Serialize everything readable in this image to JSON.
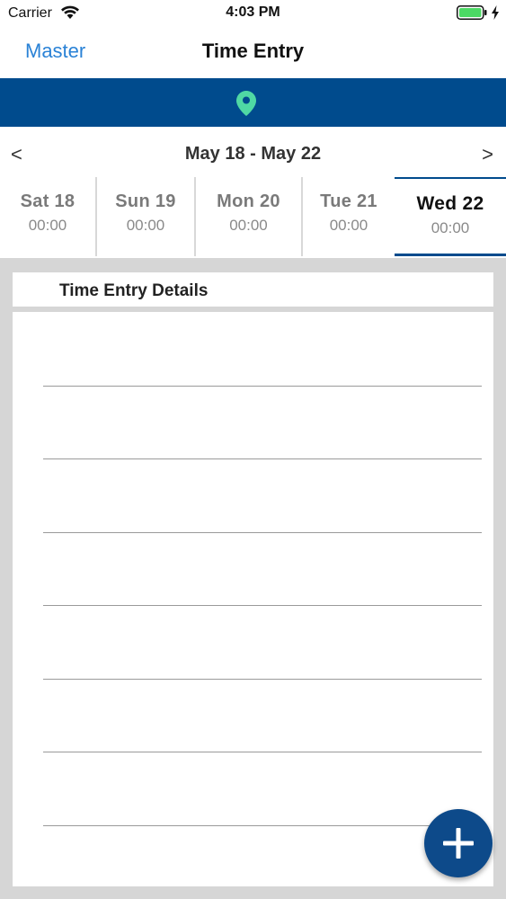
{
  "status_bar": {
    "carrier": "Carrier",
    "time": "4:03 PM",
    "icons": [
      "wifi-icon",
      "battery-icon",
      "charging-bolt-icon"
    ]
  },
  "nav": {
    "back_label": "Master",
    "title": "Time Entry"
  },
  "location_banner": {
    "icon": "location-pin-icon",
    "color": "#004b8d",
    "icon_color": "#4fd8a4"
  },
  "week": {
    "prev_label": "<",
    "next_label": ">",
    "range": "May 18 - May 22"
  },
  "days": [
    {
      "name": "Sat  18",
      "hours": "00:00",
      "selected": false
    },
    {
      "name": "Sun  19",
      "hours": "00:00",
      "selected": false
    },
    {
      "name": "Mon  20",
      "hours": "00:00",
      "selected": false
    },
    {
      "name": "Tue  21",
      "hours": "00:00",
      "selected": false
    },
    {
      "name": "Wed  22",
      "hours": "00:00",
      "selected": true
    }
  ],
  "details": {
    "title": "Time Entry Details"
  },
  "fab": {
    "icon": "plus-icon",
    "color": "#0d4a8a"
  }
}
